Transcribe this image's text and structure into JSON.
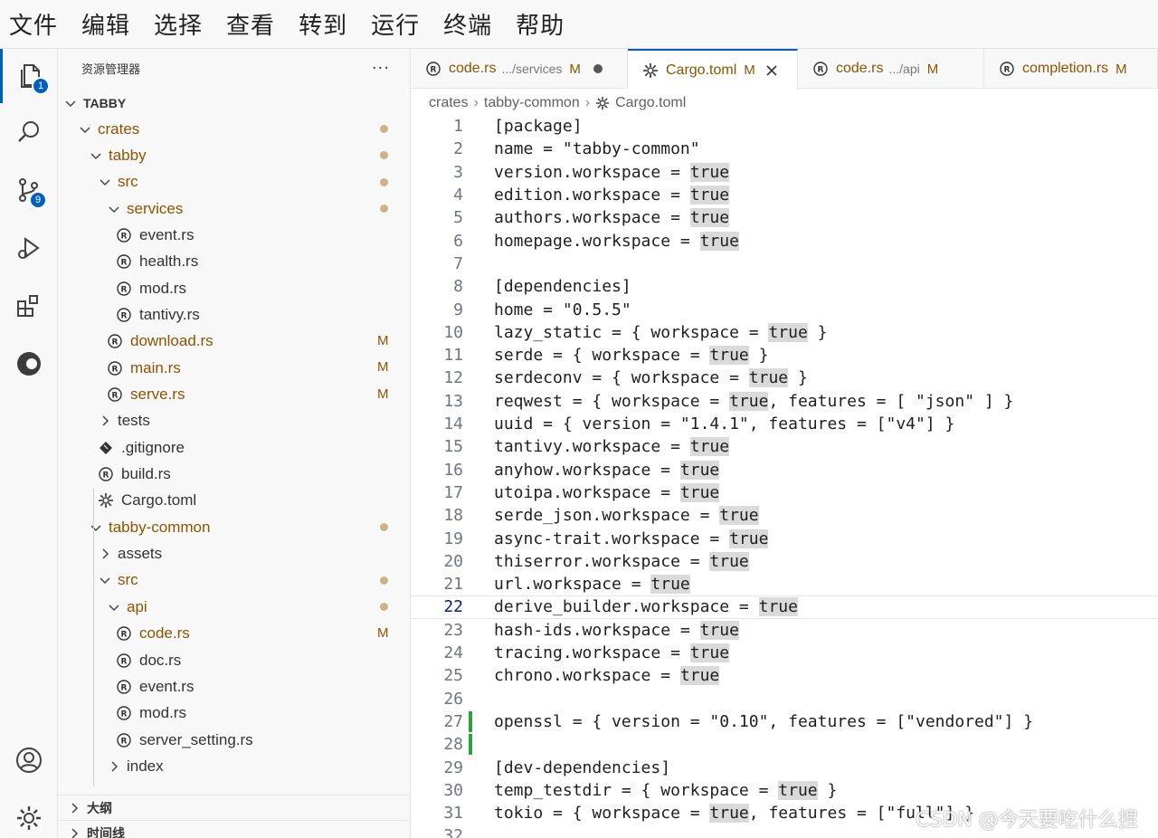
{
  "menu": [
    "文件",
    "编辑",
    "选择",
    "查看",
    "转到",
    "运行",
    "终端",
    "帮助"
  ],
  "activity": {
    "explorer_badge": "1",
    "scm_badge": "9"
  },
  "sidebar": {
    "title": "资源管理器",
    "more": "···",
    "root": "TABBY",
    "tree": [
      {
        "label": "crates",
        "kind": "folder-open",
        "depth": 1,
        "dot": true,
        "mod": true
      },
      {
        "label": "tabby",
        "kind": "folder-open",
        "depth": 2,
        "dot": true,
        "mod": true
      },
      {
        "label": "src",
        "kind": "folder-open",
        "depth": 3,
        "dot": true,
        "mod": true
      },
      {
        "label": "services",
        "kind": "folder-open",
        "depth": 4,
        "dot": true,
        "mod": true
      },
      {
        "label": "event.rs",
        "kind": "rust",
        "depth": 5
      },
      {
        "label": "health.rs",
        "kind": "rust",
        "depth": 5
      },
      {
        "label": "mod.rs",
        "kind": "rust",
        "depth": 5
      },
      {
        "label": "tantivy.rs",
        "kind": "rust",
        "depth": 5
      },
      {
        "label": "download.rs",
        "kind": "rust",
        "depth": 4,
        "mark": "M",
        "mod": true
      },
      {
        "label": "main.rs",
        "kind": "rust",
        "depth": 4,
        "mark": "M",
        "mod": true
      },
      {
        "label": "serve.rs",
        "kind": "rust",
        "depth": 4,
        "mark": "M",
        "mod": true
      },
      {
        "label": "tests",
        "kind": "folder-closed",
        "depth": 3
      },
      {
        "label": ".gitignore",
        "kind": "git",
        "depth": 3
      },
      {
        "label": "build.rs",
        "kind": "rust",
        "depth": 3
      },
      {
        "label": "Cargo.toml",
        "kind": "gear",
        "depth": 3
      },
      {
        "label": "tabby-common",
        "kind": "folder-open",
        "depth": 2,
        "dot": true,
        "mod": true
      },
      {
        "label": "assets",
        "kind": "folder-closed",
        "depth": 3
      },
      {
        "label": "src",
        "kind": "folder-open",
        "depth": 3,
        "dot": true,
        "mod": true
      },
      {
        "label": "api",
        "kind": "folder-open",
        "depth": 4,
        "dot": true,
        "mod": true
      },
      {
        "label": "code.rs",
        "kind": "rust",
        "depth": 5,
        "mark": "M",
        "mod": true
      },
      {
        "label": "doc.rs",
        "kind": "rust",
        "depth": 5
      },
      {
        "label": "event.rs",
        "kind": "rust",
        "depth": 5
      },
      {
        "label": "mod.rs",
        "kind": "rust",
        "depth": 5
      },
      {
        "label": "server_setting.rs",
        "kind": "rust",
        "depth": 5
      },
      {
        "label": "index",
        "kind": "folder-closed",
        "depth": 4
      }
    ],
    "outline_label": "大纲",
    "timeline_label": "时间线"
  },
  "tabs": [
    {
      "name": "code.rs",
      "path": ".../services",
      "mark": "M",
      "status": "dirty"
    },
    {
      "name": "Cargo.toml",
      "path": "",
      "mark": "M",
      "status": "active"
    },
    {
      "name": "code.rs",
      "path": ".../api",
      "mark": "M",
      "status": ""
    },
    {
      "name": "completion.rs",
      "path": "",
      "mark": "M",
      "status": ""
    }
  ],
  "breadcrumbs": [
    "crates",
    "tabby-common",
    "Cargo.toml"
  ],
  "editor": {
    "current_line": 22,
    "lines": [
      "[package]",
      "name = \"tabby-common\"",
      "version.workspace = true",
      "edition.workspace = true",
      "authors.workspace = true",
      "homepage.workspace = true",
      "",
      "[dependencies]",
      "home = \"0.5.5\"",
      "lazy_static = { workspace = true }",
      "serde = { workspace = true }",
      "serdeconv = { workspace = true }",
      "reqwest = { workspace = true, features = [ \"json\" ] }",
      "uuid = { version = \"1.4.1\", features = [\"v4\"] }",
      "tantivy.workspace = true",
      "anyhow.workspace = true",
      "utoipa.workspace = true",
      "serde_json.workspace = true",
      "async-trait.workspace = true",
      "thiserror.workspace = true",
      "url.workspace = true",
      "derive_builder.workspace = true",
      "hash-ids.workspace = true",
      "tracing.workspace = true",
      "chrono.workspace = true",
      "",
      "openssl = { version = \"0.10\", features = [\"vendored\"] }",
      "",
      "[dev-dependencies]",
      "temp_testdir = { workspace = true }",
      "tokio = { workspace = true, features = [\"full\"] }",
      ""
    ],
    "added_lines": [
      27,
      28
    ]
  },
  "watermark": "CSDN @今天要吃什么捏"
}
